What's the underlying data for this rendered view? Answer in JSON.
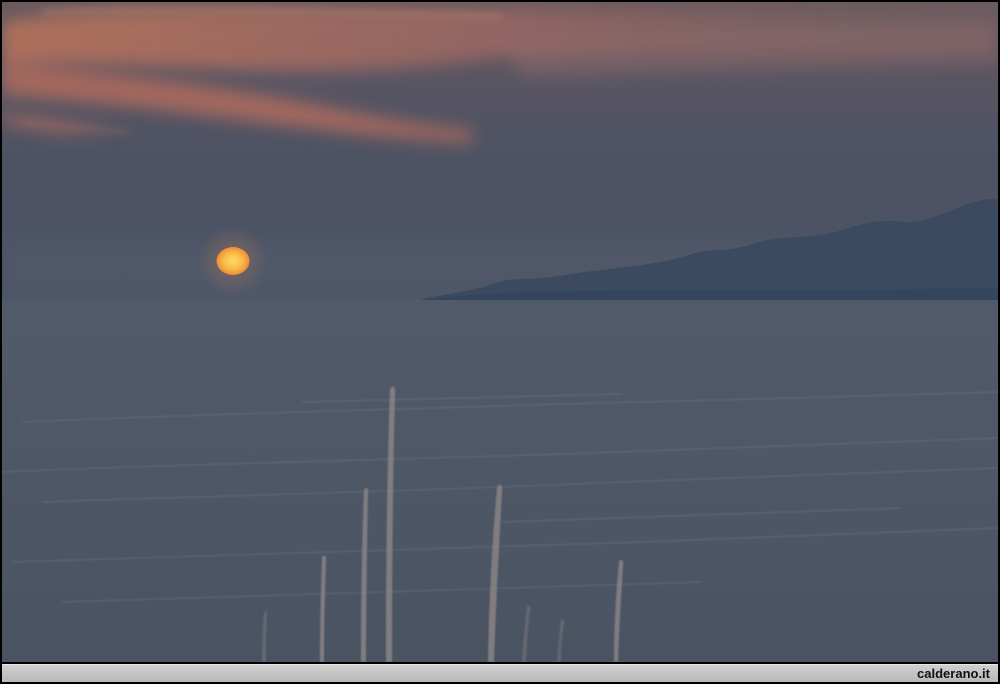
{
  "photo": {
    "subject": "sunset-over-sea",
    "colors": {
      "sky_top": "#5e5560",
      "sky_mid": "#4f5261",
      "sky_horizon": "#4b5364",
      "cloud_glow": "#c47a5a",
      "sun": "#f6b540",
      "sun_core": "#ffd36a",
      "headland": "#3c4a5d",
      "sea": "#4c5767",
      "reeds": "#7a7678"
    }
  },
  "footer": {
    "watermark": "calderano.it"
  }
}
